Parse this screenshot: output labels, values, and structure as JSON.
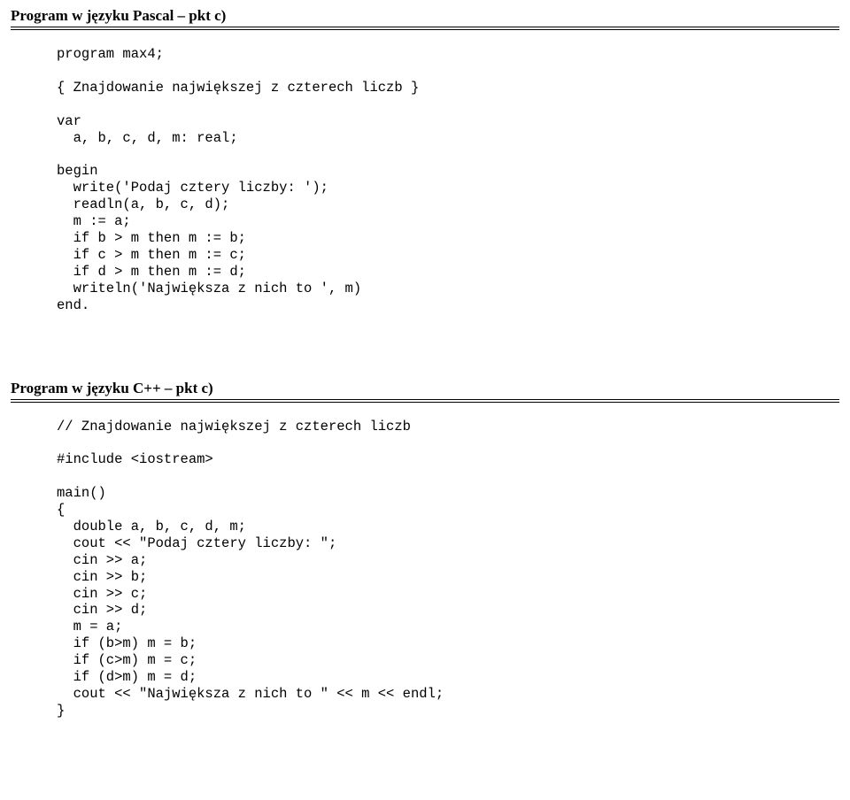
{
  "pascal": {
    "heading": "Program w języku Pascal – pkt c)",
    "code": "program max4;\n\n{ Znajdowanie największej z czterech liczb }\n\nvar\n  a, b, c, d, m: real;\n\nbegin\n  write('Podaj cztery liczby: ');\n  readln(a, b, c, d);\n  m := a;\n  if b > m then m := b;\n  if c > m then m := c;\n  if d > m then m := d;\n  writeln('Największa z nich to ', m)\nend."
  },
  "cpp": {
    "heading": "Program w języku C++ – pkt c)",
    "code": "// Znajdowanie największej z czterech liczb\n\n#include <iostream>\n\nmain()\n{\n  double a, b, c, d, m;\n  cout << \"Podaj cztery liczby: \";\n  cin >> a;\n  cin >> b;\n  cin >> c;\n  cin >> d;\n  m = a;\n  if (b>m) m = b;\n  if (c>m) m = c;\n  if (d>m) m = d;\n  cout << \"Największa z nich to \" << m << endl;\n}"
  }
}
